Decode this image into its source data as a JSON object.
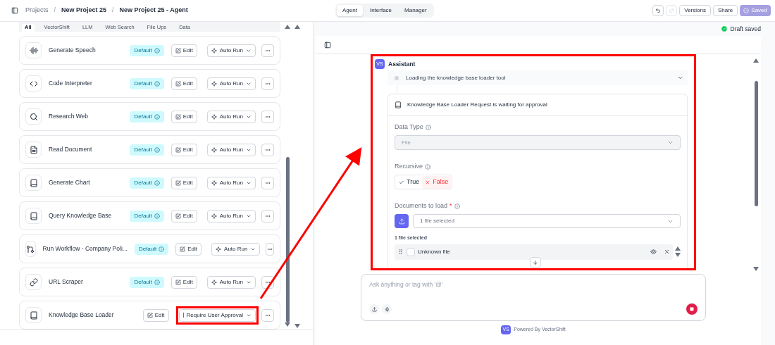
{
  "breadcrumbs": [
    {
      "label": "Projects",
      "current": false
    },
    {
      "separator": "/",
      "label": "New Project 25",
      "current": true
    },
    {
      "separator": "/",
      "label": "New Project 25 - Agent",
      "current": true
    }
  ],
  "mode_tabs": [
    {
      "label": "Agent",
      "selected": true
    },
    {
      "label": "Interface",
      "selected": false
    },
    {
      "label": "Manager",
      "selected": false
    }
  ],
  "actions": {
    "versions": "Versions",
    "share": "Share",
    "saved": "Saved"
  },
  "filter_tabs": [
    {
      "label": "All",
      "selected": true
    },
    {
      "label": "VectorShift",
      "selected": false
    },
    {
      "label": "LLM",
      "selected": false
    },
    {
      "label": "Web Search",
      "selected": false
    },
    {
      "label": "File Ups",
      "selected": false
    },
    {
      "label": "Data",
      "selected": false
    }
  ],
  "tools": [
    {
      "kind": "speech",
      "name": "Generate Speech",
      "badge": "Default",
      "edit": "Edit",
      "approval_required": false,
      "run": "Auto Run",
      "highlighted": false
    },
    {
      "kind": "code",
      "name": "Code Interpreter",
      "badge": "Default",
      "edit": "Edit",
      "approval_required": false,
      "run": "Auto Run",
      "highlighted": false
    },
    {
      "kind": "search",
      "name": "Research Web",
      "badge": "Default",
      "edit": "Edit",
      "approval_required": false,
      "run": "Auto Run",
      "highlighted": false
    },
    {
      "kind": "document",
      "name": "Read Document",
      "badge": "Default",
      "edit": "Edit",
      "approval_required": false,
      "run": "Auto Run",
      "highlighted": false
    },
    {
      "kind": "book",
      "name": "Generate Chart",
      "badge": "Default",
      "edit": "Edit",
      "approval_required": false,
      "run": "Auto Run",
      "highlighted": false
    },
    {
      "kind": "book",
      "name": "Query Knowledge Base",
      "badge": "Default",
      "edit": "Edit",
      "approval_required": false,
      "run": "Auto Run",
      "highlighted": false
    },
    {
      "kind": "workflow",
      "name": "Run Workflow - Company Poli...",
      "badge": "Default",
      "edit": "Edit",
      "approval_required": false,
      "run": "Auto Run",
      "highlighted": false
    },
    {
      "kind": "link",
      "name": "URL Scraper",
      "badge": "Default",
      "edit": "Edit",
      "approval_required": false,
      "run": "Auto Run",
      "highlighted": false
    },
    {
      "kind": "book",
      "name": "Knowledge Base Loader",
      "edit": "Edit",
      "approval_required": true,
      "run": "Require User Approval",
      "highlighted": true
    }
  ],
  "status": "Draft saved",
  "chat": {
    "avatar": "VS",
    "sender": "Assistant",
    "step": "Loading the knowledge base loader tool",
    "highlighted": true,
    "request": {
      "title": "Knowledge Base Loader Request is waiting for approval",
      "data_type": {
        "label": "Data Type",
        "value": "File"
      },
      "recursive": {
        "label": "Recursive",
        "options": [
          {
            "kind": "yes",
            "label": "True",
            "selected": false
          },
          {
            "kind": "no",
            "label": "False",
            "selected": true
          }
        ]
      },
      "documents": {
        "label": "Documents to load",
        "required_mark": "*",
        "value": "1 file selected",
        "count": "1 file selected",
        "files": [
          {
            "name": "Unknown file"
          }
        ]
      }
    }
  },
  "composer": {
    "placeholder": "Ask anything or tag with '@'"
  },
  "footer": {
    "logo": "VS",
    "text": "Powered By VectorShift"
  }
}
